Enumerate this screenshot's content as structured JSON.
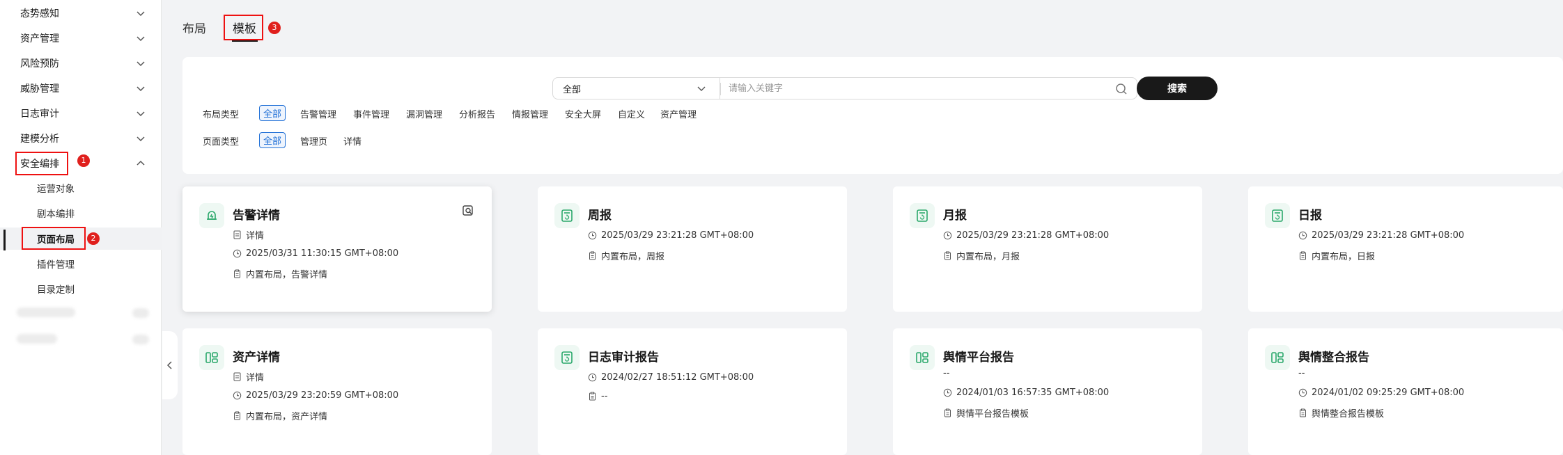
{
  "sidebar": {
    "items": [
      {
        "label": "态势感知"
      },
      {
        "label": "资产管理"
      },
      {
        "label": "风险预防"
      },
      {
        "label": "威胁管理"
      },
      {
        "label": "日志审计"
      },
      {
        "label": "建模分析"
      },
      {
        "label": "安全编排"
      }
    ],
    "sub_items": [
      {
        "label": "运营对象"
      },
      {
        "label": "剧本编排"
      },
      {
        "label": "页面布局"
      },
      {
        "label": "插件管理"
      },
      {
        "label": "目录定制"
      }
    ]
  },
  "steps": {
    "one": "1",
    "two": "2",
    "three": "3"
  },
  "tabs": [
    {
      "label": "布局"
    },
    {
      "label": "模板"
    }
  ],
  "search": {
    "scope": "全部",
    "placeholder": "请输入关键字",
    "button": "搜索"
  },
  "filters": {
    "layout_type": {
      "label": "布局类型",
      "options": [
        "全部",
        "告警管理",
        "事件管理",
        "漏洞管理",
        "分析报告",
        "情报管理",
        "安全大屏",
        "自定义",
        "资产管理"
      ]
    },
    "page_type": {
      "label": "页面类型",
      "options": [
        "全部",
        "管理页",
        "详情"
      ]
    }
  },
  "cards": [
    {
      "title": "告警详情",
      "type": "详情",
      "time": "2025/03/31 11:30:15 GMT+08:00",
      "desc": "内置布局，告警详情",
      "icon": "bell-icon"
    },
    {
      "title": "周报",
      "time": "2025/03/29 23:21:28 GMT+08:00",
      "desc": "内置布局，周报",
      "icon": "report-icon"
    },
    {
      "title": "月报",
      "time": "2025/03/29 23:21:28 GMT+08:00",
      "desc": "内置布局，月报",
      "icon": "report-icon"
    },
    {
      "title": "日报",
      "time": "2025/03/29 23:21:28 GMT+08:00",
      "desc": "内置布局，日报",
      "icon": "report-icon"
    },
    {
      "title": "资产详情",
      "type": "详情",
      "time": "2025/03/29 23:20:59 GMT+08:00",
      "desc": "内置布局，资产详情",
      "icon": "layout-icon"
    },
    {
      "title": "日志审计报告",
      "time": "2024/02/27 18:51:12 GMT+08:00",
      "desc": "--",
      "icon": "report-icon"
    },
    {
      "title": "舆情平台报告",
      "type": "--",
      "time": "2024/01/03 16:57:35 GMT+08:00",
      "desc": "舆情平台报告模板",
      "icon": "layout-icon"
    },
    {
      "title": "舆情整合报告",
      "type": "--",
      "time": "2024/01/02 09:25:29 GMT+08:00",
      "desc": "舆情整合报告模板",
      "icon": "layout-icon"
    }
  ],
  "colors": {
    "accent": "#1f6fd6",
    "icon_green": "#2aa86b",
    "highlight": "#e0201d"
  }
}
